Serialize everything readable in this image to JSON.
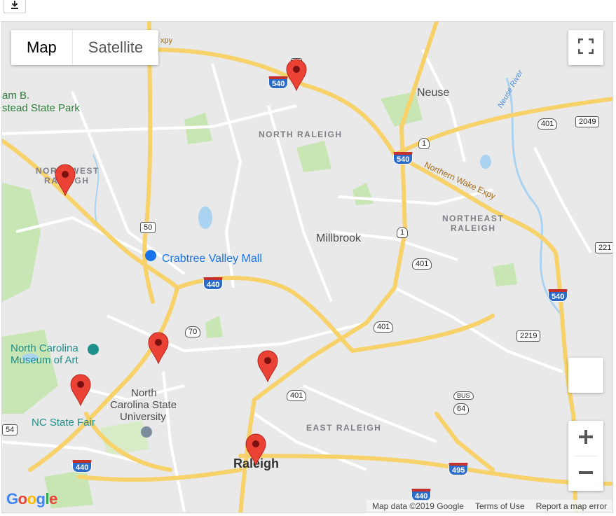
{
  "toolbar": {
    "download_icon": "download-icon"
  },
  "map_type": {
    "map_label": "Map",
    "satellite_label": "Satellite",
    "selected": "Map"
  },
  "controls": {
    "fullscreen_icon": "fullscreen-icon",
    "zoom_in": "+",
    "zoom_out": "−"
  },
  "labels": {
    "expy_fragment": "xpy",
    "park": "am B.\nstead State Park",
    "park_line1": "am B.",
    "park_line2": "stead State Park",
    "neuse": "Neuse",
    "neuse_river": "Neuse River",
    "north_raleigh": "NORTH RALEIGH",
    "northwest_raleigh_1": "NORTHWEST",
    "northwest_raleigh_2": "RALEIGH",
    "northern_wake_expy": "Northern Wake Expy",
    "northeast_raleigh_1": "NORTHEAST",
    "northeast_raleigh_2": "RALEIGH",
    "millbrook": "Millbrook",
    "crabtree": "Crabtree Valley Mall",
    "museum_1": "North Carolina",
    "museum_2": "Museum of Art",
    "ncsu_1": "North",
    "ncsu_2": "Carolina State",
    "ncsu_3": "University",
    "state_fair": "NC State Fair",
    "east_raleigh": "EAST RALEIGH",
    "raleigh": "Raleigh"
  },
  "shields": {
    "i540_top": "540",
    "i540_mid": "540",
    "i540_right": "540",
    "us1_a": "1",
    "us1_b": "1",
    "us401_a": "401",
    "us401_b": "401",
    "us401_c": "401",
    "us401_d": "401",
    "nc50": "50",
    "us70": "70",
    "i440_a": "440",
    "i440_b": "440",
    "i440_c": "440",
    "sr2049": "2049",
    "sr221": "221",
    "sr2219": "2219",
    "bus64_top": "BUS",
    "bus64": "64",
    "i495": "495",
    "nc54": "54",
    "top_clip": "5"
  },
  "markers": [
    {
      "name": "marker-north",
      "color": "#ea4335"
    },
    {
      "name": "marker-northwest",
      "color": "#ea4335"
    },
    {
      "name": "marker-west-central",
      "color": "#ea4335"
    },
    {
      "name": "marker-state-fair",
      "color": "#ea4335"
    },
    {
      "name": "marker-central",
      "color": "#ea4335"
    },
    {
      "name": "marker-downtown",
      "color": "#ea4335"
    }
  ],
  "footer": {
    "map_data": "Map data ©2019 Google",
    "terms": "Terms of Use",
    "report": "Report a map error",
    "logo": "Google"
  },
  "colors": {
    "highway": "#f7d26a",
    "road": "#ffffff",
    "park": "#c8e6b4",
    "water": "#aad3f2",
    "marker": "#ea4335"
  }
}
